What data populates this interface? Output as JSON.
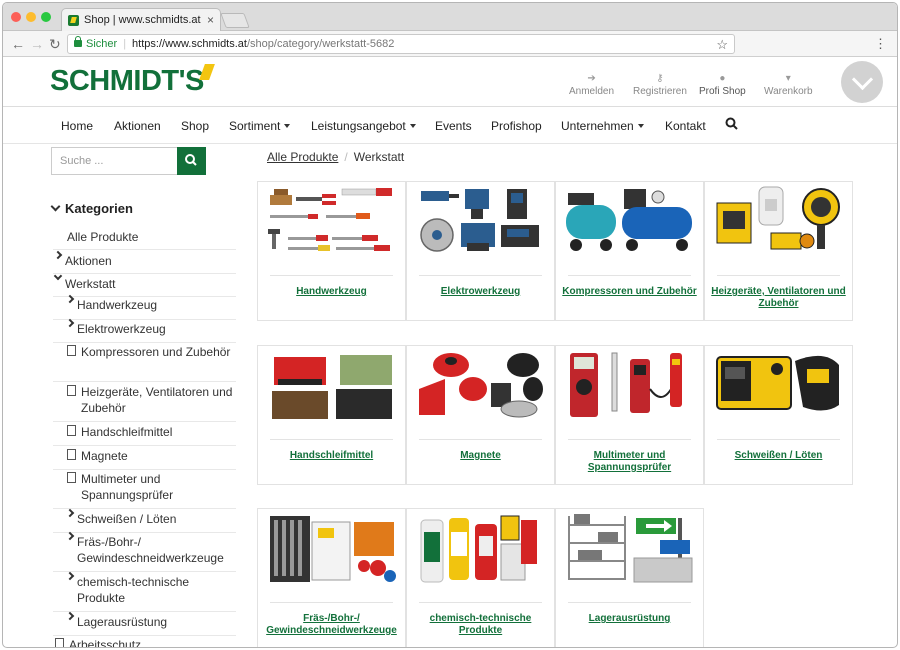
{
  "browser": {
    "tab_title": "Shop | www.schmidts.at",
    "url_secure_label": "Sicher",
    "url_host": "https://www.schmidts.at",
    "url_path": "/shop/category/werkstatt-5682"
  },
  "header": {
    "logo_text": "SCHMIDT'S",
    "links": [
      {
        "label": "Anmelden",
        "icon": "login-icon"
      },
      {
        "label": "Registrieren",
        "icon": "key-icon"
      },
      {
        "label": "Profi Shop",
        "icon": "user-icon"
      },
      {
        "label": "Warenkorb",
        "icon": "cart-icon"
      }
    ]
  },
  "nav": {
    "items": [
      "Home",
      "Aktionen",
      "Shop",
      "Sortiment",
      "Leistungsangebot",
      "Events",
      "Profishop",
      "Unternehmen",
      "Kontakt"
    ]
  },
  "search": {
    "placeholder": "Suche ..."
  },
  "sidebar": {
    "title": "Kategorien",
    "items": [
      {
        "label": "Alle Produkte"
      },
      {
        "label": "Aktionen"
      },
      {
        "label": "Werkstatt"
      },
      {
        "label": "Handwerkzeug"
      },
      {
        "label": "Elektrowerkzeug"
      },
      {
        "label": "Kompressoren und Zubehör"
      },
      {
        "label": "Heizgeräte, Ventilatoren und Zubehör"
      },
      {
        "label": "Handschleifmittel"
      },
      {
        "label": "Magnete"
      },
      {
        "label": "Multimeter und Spannungsprüfer"
      },
      {
        "label": "Schweißen / Löten"
      },
      {
        "label": "Fräs-/Bohr-/ Gewindeschneidwerkzeuge"
      },
      {
        "label": "chemisch-technische Produkte"
      },
      {
        "label": "Lagerausrüstung"
      },
      {
        "label": "Arbeitsschutz"
      }
    ]
  },
  "breadcrumb": {
    "root": "Alle Produkte",
    "current": "Werkstatt"
  },
  "products": [
    {
      "label": "Handwerkzeug"
    },
    {
      "label": "Elektrowerkzeug"
    },
    {
      "label": "Kompressoren und Zubehör"
    },
    {
      "label": "Heizgeräte, Ventilatoren und Zubehör"
    },
    {
      "label": "Handschleifmittel"
    },
    {
      "label": "Magnete"
    },
    {
      "label": "Multimeter und Spannungsprüfer"
    },
    {
      "label": "Schweißen / Löten"
    },
    {
      "label": "Fräs-/Bohr-/ Gewindeschneidwerkzeuge"
    },
    {
      "label": "chemisch-technische Produkte"
    },
    {
      "label": "Lagerausrüstung"
    }
  ],
  "colors": {
    "brand": "#12703a",
    "accent": "#f3c510"
  }
}
